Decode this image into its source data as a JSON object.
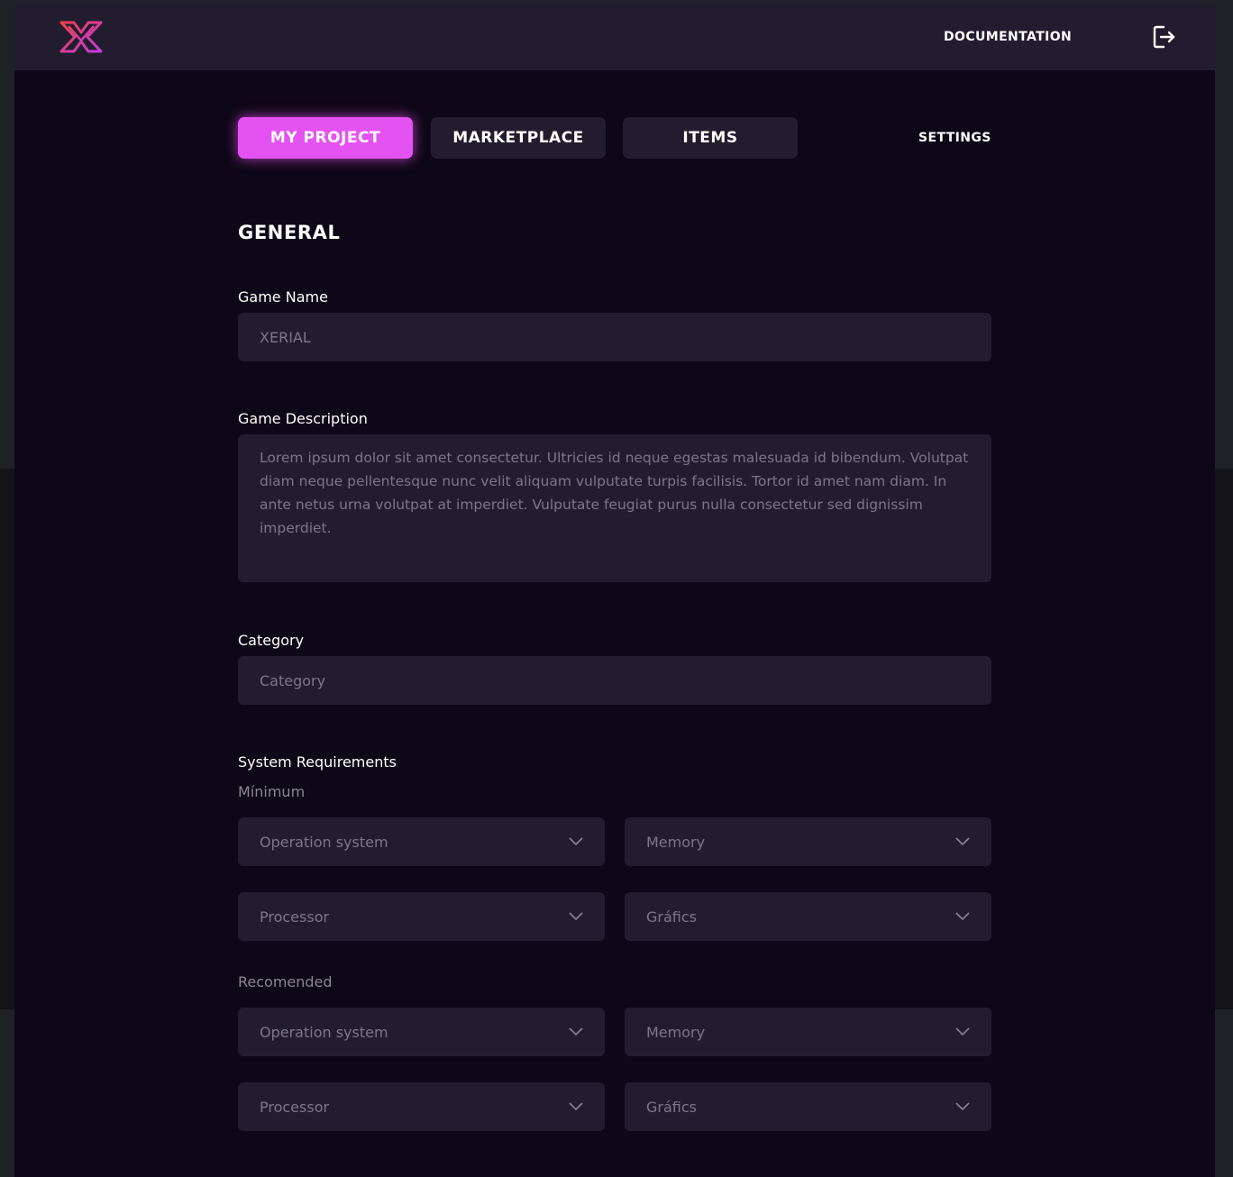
{
  "header": {
    "documentation_label": "DOCUMENTATION",
    "logo_gradient": [
      "#f0404a",
      "#c23de0"
    ]
  },
  "nav": {
    "tabs": [
      {
        "label": "MY PROJECT",
        "active": true
      },
      {
        "label": "MARKETPLACE",
        "active": false
      },
      {
        "label": "ITEMS",
        "active": false
      }
    ],
    "settings_label": "SETTINGS"
  },
  "form": {
    "section_title": "GENERAL",
    "game_name": {
      "label": "Game Name",
      "value": "XERIAL"
    },
    "game_description": {
      "label": "Game Description",
      "value": "Lorem ipsum dolor sit amet consectetur. Ultricies id neque egestas malesuada id bibendum. Volutpat diam neque pellentesque nunc velit aliquam vulputate turpis facilisis. Tortor id amet nam diam. In ante netus urna volutpat at imperdiet. Vulputate feugiat purus nulla consectetur sed dignissim imperdiet."
    },
    "category": {
      "label": "Category",
      "placeholder": "Category"
    },
    "system_requirements": {
      "label": "System Requirements",
      "minimum": {
        "label": "Mínimum",
        "operation_system": "Operation system",
        "memory": "Memory",
        "processor": "Processor",
        "graphics": "Gráfics"
      },
      "recommended": {
        "label": "Recomended",
        "operation_system": "Operation system",
        "memory": "Memory",
        "processor": "Processor",
        "graphics": "Gráfics"
      }
    }
  },
  "colors": {
    "accent": "#e552f2",
    "background": "#0e0717",
    "surface": "#221d2e",
    "placeholder_text": "#7c7688"
  }
}
